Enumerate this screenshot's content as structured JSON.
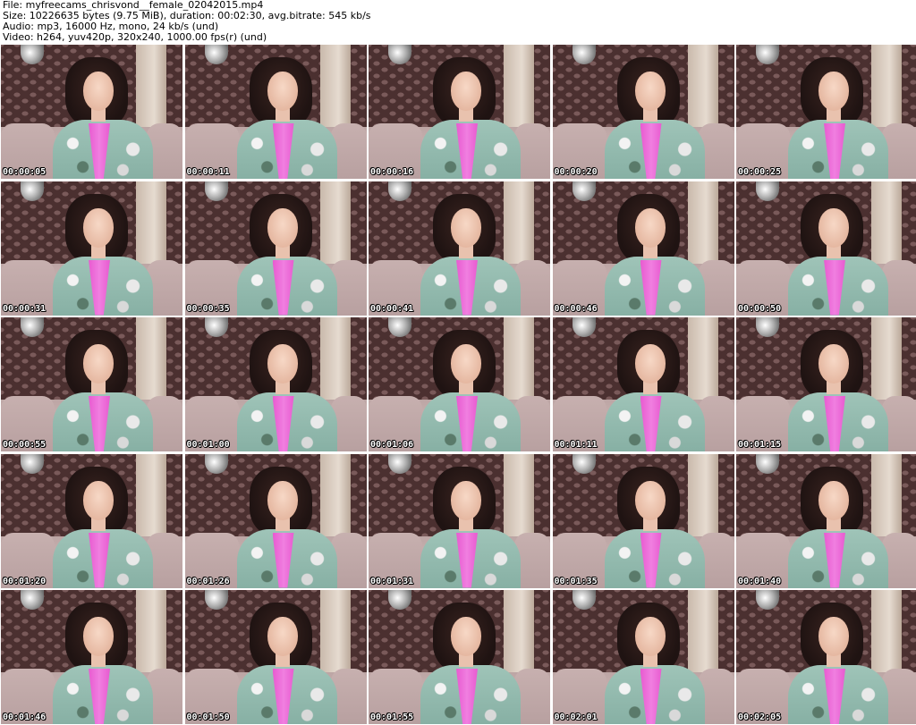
{
  "header": {
    "file_line": "File: myfreecams_chrisvond__female_02042015.mp4",
    "size_line": "Size: 10226635 bytes (9.75 MiB), duration: 00:02:30, avg.bitrate: 545 kb/s",
    "audio_line": "Audio: mp3, 16000 Hz, mono, 24 kb/s (und)",
    "video_line": "Video: h264, yuv420p, 320x240, 1000.00 fps(r) (und)"
  },
  "frames": [
    {
      "timestamp": "00:00:05"
    },
    {
      "timestamp": "00:00:11"
    },
    {
      "timestamp": "00:00:16"
    },
    {
      "timestamp": "00:00:20"
    },
    {
      "timestamp": "00:00:25"
    },
    {
      "timestamp": "00:00:31"
    },
    {
      "timestamp": "00:00:35"
    },
    {
      "timestamp": "00:00:41"
    },
    {
      "timestamp": "00:00:46"
    },
    {
      "timestamp": "00:00:50"
    },
    {
      "timestamp": "00:00:55"
    },
    {
      "timestamp": "00:01:00"
    },
    {
      "timestamp": "00:01:06"
    },
    {
      "timestamp": "00:01:11"
    },
    {
      "timestamp": "00:01:15"
    },
    {
      "timestamp": "00:01:20"
    },
    {
      "timestamp": "00:01:26"
    },
    {
      "timestamp": "00:01:31"
    },
    {
      "timestamp": "00:01:35"
    },
    {
      "timestamp": "00:01:40"
    },
    {
      "timestamp": "00:01:46"
    },
    {
      "timestamp": "00:01:50"
    },
    {
      "timestamp": "00:01:55"
    },
    {
      "timestamp": "00:02:01"
    },
    {
      "timestamp": "00:02:05"
    }
  ]
}
